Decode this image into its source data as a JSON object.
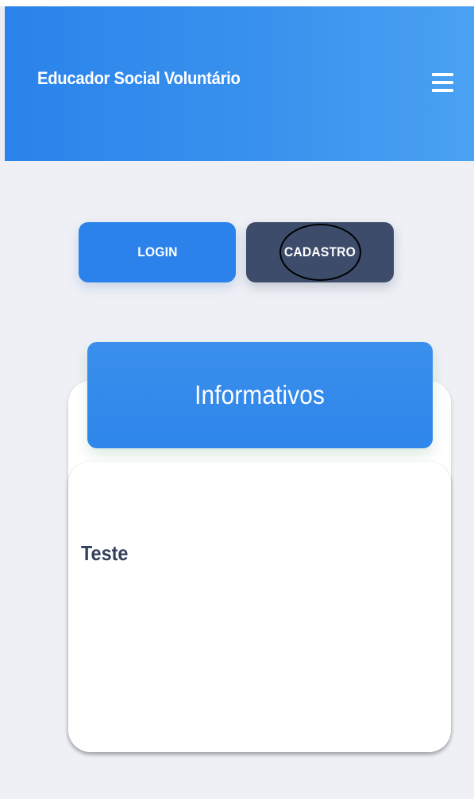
{
  "header": {
    "title": "Educador Social Voluntário",
    "menu_icon": "hamburger-menu-icon"
  },
  "auth": {
    "login_label": "LOGIN",
    "cadastro_label": "CADASTRO"
  },
  "informativos": {
    "title": "Informativos",
    "items": [
      {
        "title": "Teste"
      }
    ]
  },
  "colors": {
    "primary": "#2b82ea",
    "secondary": "#3d4c6b",
    "background": "#eef0f5",
    "text_dark": "#33415c"
  }
}
